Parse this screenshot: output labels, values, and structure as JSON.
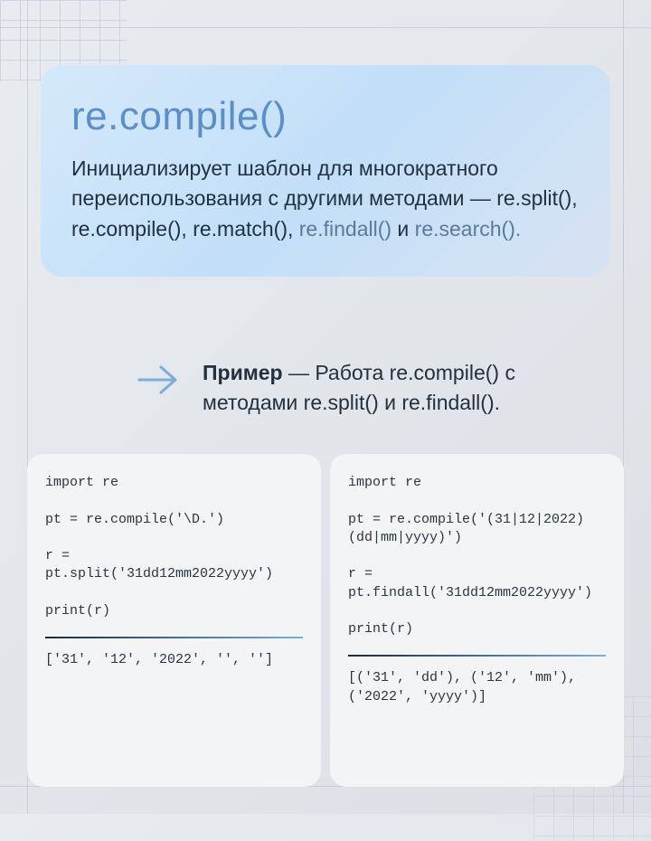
{
  "card": {
    "title": "re.compile()",
    "description_parts": {
      "p1": "Инициализирует шаблон для многократного переиспользования с другими методами — re.split(), re.compile(), re.match(), ",
      "muted1": "re.findall()",
      "p2": " и ",
      "muted2": "re.search().",
      "p3": ""
    }
  },
  "example": {
    "label_bold": "Пример",
    "label_rest": " — Работа re.compile() с методами re.split() и re.findall()."
  },
  "panels": {
    "left": {
      "code": "import re\n\npt = re.compile('\\D.')\n\nr = pt.split('31dd12mm2022yyyy')\n\nprint(r)",
      "output": "['31', '12', '2022', '', '']"
    },
    "right": {
      "code": "import re\n\npt = re.compile('(31|12|2022)(dd|mm|yyyy)')\n\nr = pt.findall('31dd12mm2022yyyy')\n\nprint(r)",
      "output": "[('31', 'dd'), ('12', 'mm'), ('2022', 'yyyy')]"
    }
  }
}
